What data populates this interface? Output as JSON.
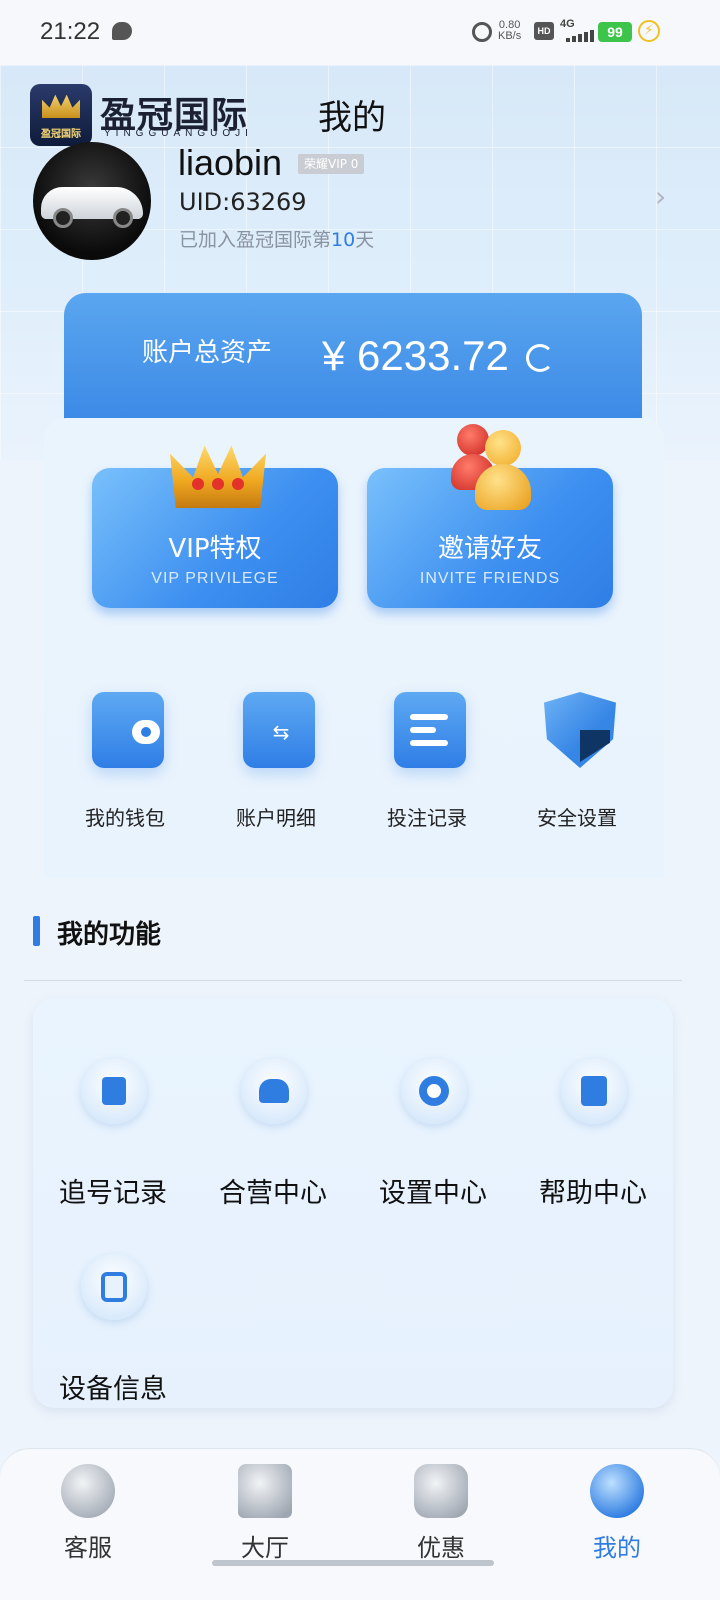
{
  "status_bar": {
    "time": "21:22",
    "speed_value": "0.80",
    "speed_unit": "KB/s",
    "hd": "HD",
    "network": "4G",
    "battery": "99"
  },
  "header": {
    "brand_name": "盈冠国际",
    "brand_pinyin": "YINGGUANGUOJI",
    "logo_text": "盈冠国际",
    "page_title": "我的"
  },
  "profile": {
    "username": "liaobin",
    "vip_badge": "荣耀VIP 0",
    "uid": "UID:63269",
    "joined_prefix": "已加入盈冠国际第",
    "joined_days": "10",
    "joined_suffix": "天"
  },
  "assets": {
    "label": "账户总资产",
    "value": "¥ 6233.72"
  },
  "promos": [
    {
      "title": "VIP特权",
      "subtitle": "VIP PRIVILEGE",
      "icon": "crown-icon"
    },
    {
      "title": "邀请好友",
      "subtitle": "INVITE FRIENDS",
      "icon": "friends-icon"
    }
  ],
  "quick_actions": [
    {
      "label": "我的钱包",
      "icon": "wallet-icon"
    },
    {
      "label": "账户明细",
      "icon": "folder-transfer-icon"
    },
    {
      "label": "投注记录",
      "icon": "list-icon"
    },
    {
      "label": "安全设置",
      "icon": "shield-icon"
    }
  ],
  "features": {
    "title": "我的功能",
    "items": [
      {
        "label": "追号记录",
        "icon": "document-icon"
      },
      {
        "label": "合营中心",
        "icon": "handshake-icon"
      },
      {
        "label": "设置中心",
        "icon": "gear-icon"
      },
      {
        "label": "帮助中心",
        "icon": "book-icon"
      },
      {
        "label": "设备信息",
        "icon": "tablet-icon"
      }
    ]
  },
  "bottom_nav": {
    "items": [
      {
        "label": "客服",
        "icon": "support-icon"
      },
      {
        "label": "大厅",
        "icon": "home-icon"
      },
      {
        "label": "优惠",
        "icon": "gift-icon"
      },
      {
        "label": "我的",
        "icon": "user-icon"
      }
    ],
    "active": "我的",
    "accent_color": "#2f7de1"
  }
}
